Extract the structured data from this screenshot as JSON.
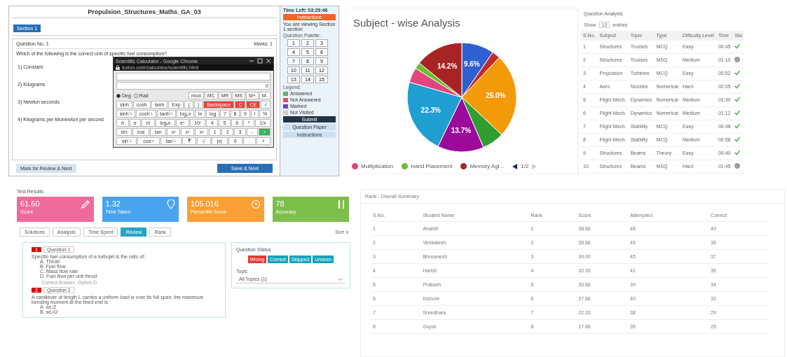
{
  "exam": {
    "title": "Propulsion_Structures_Maths_GA_03",
    "section_button": "Section 1",
    "question_heading": "Question No. 1",
    "marks": "Marks: 1",
    "question": "Which of the following is the correct unit of specific fuel consumption?",
    "options": [
      "1) Constant",
      "2) Kilograms",
      "3) Newton seconds",
      "4) Kilograms per kilonewton per second"
    ],
    "back_button": "Mark for Review & Next",
    "next_button": "Save & Next",
    "calculator": {
      "title": "Scientific Calculator - Google Chrome",
      "url": "tcsion.com/calculator/scientific.html",
      "display": "0",
      "modes": [
        {
          "label": "Deg",
          "selected": true
        },
        {
          "label": "Rad",
          "selected": false
        }
      ],
      "keys": [
        [
          {
            "label": "mod",
            "kind": "std"
          },
          {
            "label": "MC",
            "kind": "std"
          },
          {
            "label": "MR",
            "kind": "std"
          },
          {
            "label": "MS",
            "kind": "std"
          },
          {
            "label": "M+",
            "kind": "std"
          },
          {
            "label": "M-",
            "kind": "std"
          }
        ],
        [
          {
            "label": "sinh",
            "kind": "std"
          },
          {
            "label": "cosh",
            "kind": "std"
          },
          {
            "label": "tanh",
            "kind": "std"
          },
          {
            "label": "Exp",
            "kind": "std"
          },
          {
            "label": "(",
            "kind": "std"
          },
          {
            "label": ")",
            "kind": "std"
          },
          {
            "label": "Backspace",
            "kind": "danger"
          },
          {
            "label": "C",
            "kind": "danger"
          },
          {
            "label": "CE",
            "kind": "danger"
          },
          {
            "label": "√",
            "kind": "std"
          }
        ],
        [
          {
            "label": "sinh⁻¹",
            "kind": "std"
          },
          {
            "label": "cosh⁻¹",
            "kind": "std"
          },
          {
            "label": "tanh⁻¹",
            "kind": "std"
          },
          {
            "label": "log₂x",
            "kind": "std"
          },
          {
            "label": "ln",
            "kind": "std"
          },
          {
            "label": "log",
            "kind": "std"
          },
          {
            "label": "7",
            "kind": "std"
          },
          {
            "label": "8",
            "kind": "std"
          },
          {
            "label": "9",
            "kind": "std"
          },
          {
            "label": "/",
            "kind": "std"
          },
          {
            "label": "%",
            "kind": "std"
          }
        ],
        [
          {
            "label": "π",
            "kind": "std"
          },
          {
            "label": "e",
            "kind": "std"
          },
          {
            "label": "n!",
            "kind": "std"
          },
          {
            "label": "logᵧx",
            "kind": "std"
          },
          {
            "label": "eˣ",
            "kind": "std"
          },
          {
            "label": "10ˣ",
            "kind": "std"
          },
          {
            "label": "4",
            "kind": "std"
          },
          {
            "label": "5",
            "kind": "std"
          },
          {
            "label": "6",
            "kind": "std"
          },
          {
            "label": "*",
            "kind": "std"
          },
          {
            "label": "1/x",
            "kind": "std"
          }
        ],
        [
          {
            "label": "sin",
            "kind": "std"
          },
          {
            "label": "cos",
            "kind": "std"
          },
          {
            "label": "tan",
            "kind": "std"
          },
          {
            "label": "xʸ",
            "kind": "std"
          },
          {
            "label": "x³",
            "kind": "std"
          },
          {
            "label": "x²",
            "kind": "std"
          },
          {
            "label": "1",
            "kind": "std"
          },
          {
            "label": "2",
            "kind": "std"
          },
          {
            "label": "3",
            "kind": "std"
          },
          {
            "label": "-",
            "kind": "std"
          },
          {
            "label": "=",
            "kind": "equals"
          }
        ],
        [
          {
            "label": "sin⁻¹",
            "kind": "std"
          },
          {
            "label": "cos⁻¹",
            "kind": "std"
          },
          {
            "label": "tan⁻¹",
            "kind": "std"
          },
          {
            "label": "∛",
            "kind": "std"
          },
          {
            "label": "√",
            "kind": "std"
          },
          {
            "label": "|x|",
            "kind": "std"
          },
          {
            "label": "0",
            "kind": "std"
          },
          {
            "label": ".",
            "kind": "std"
          },
          {
            "label": "+",
            "kind": "std"
          }
        ]
      ]
    },
    "sidebar": {
      "time_left": "Time Left: 03:29:46",
      "instructions_button": "Instructions",
      "viewing_text": "You are viewing Section 1 section",
      "palette_heading": "Question Palette:",
      "questions": [
        "1",
        "2",
        "3",
        "4",
        "5",
        "6",
        "7",
        "8",
        "9",
        "10",
        "11",
        "12",
        "13",
        "14",
        "15"
      ],
      "legend_heading": "Legend:",
      "legend": [
        {
          "label": "Answered",
          "color": "#5cb85c"
        },
        {
          "label": "Not Answered",
          "color": "#d9534f"
        },
        {
          "label": "Marked",
          "color": "#6f42c1"
        },
        {
          "label": "Not Visited",
          "color": "#cccccc"
        }
      ],
      "submit_button": "Submit",
      "paper_button": "Question Paper",
      "instructions_link": "Instructions"
    }
  },
  "subject_analysis": {
    "chart_data": {
      "type": "pie",
      "title": "Subject - wise Analysis",
      "series": [
        {
          "values": [
            9.6,
            2.4,
            25.0,
            6.5,
            13.7,
            22.3,
            4.4,
            1.9,
            14.2
          ]
        }
      ],
      "colors": [
        "#2f5fd0",
        "#c62828",
        "#f39a0b",
        "#2e9e2e",
        "#9c0a9c",
        "#1f9ed1",
        "#e0457b",
        "#6bbf2f",
        "#a82424"
      ],
      "value_labels": [
        "9.6%",
        null,
        "25.0%",
        null,
        "13.7%",
        "22.3%",
        null,
        null,
        "14.2%"
      ]
    },
    "legend": [
      {
        "label": "Multiplication",
        "color": "#e0457b"
      },
      {
        "label": "Hand Placement",
        "color": "#6bbf2f"
      },
      {
        "label": "Memory Agi...",
        "color": "#a82424"
      }
    ],
    "page": "1/2"
  },
  "question_analysis": {
    "title": "Question Analysis",
    "show_label": "Show",
    "entries_value": "10",
    "entries_label": "entries",
    "columns": [
      "S.No.",
      "Subject",
      "Topic",
      "Type",
      "Difficulty Level",
      "Time",
      "Sta"
    ],
    "rows": [
      {
        "cells": [
          "1",
          "Structures",
          "Trusses",
          "MCQ",
          "Easy",
          "00:45"
        ],
        "correct": true
      },
      {
        "cells": [
          "2",
          "Structures",
          "Trusses",
          "MSQ",
          "Medium",
          "01:10"
        ],
        "correct": false
      },
      {
        "cells": [
          "3",
          "Propulsion",
          "Turbines",
          "MCQ",
          "Easy",
          "00:52"
        ],
        "correct": true
      },
      {
        "cells": [
          "4",
          "Aero",
          "Nozzles",
          "Numerical",
          "Hard",
          "02:05"
        ],
        "correct": true
      },
      {
        "cells": [
          "5",
          "Flight Mech.",
          "Dynamics",
          "Numerical",
          "Medium",
          "01:30"
        ],
        "correct": true
      },
      {
        "cells": [
          "6",
          "Flight Mech.",
          "Dynamics",
          "Numerical",
          "Medium",
          "01:12"
        ],
        "correct": true
      },
      {
        "cells": [
          "7",
          "Flight Mech.",
          "Stability",
          "MCQ",
          "Easy",
          "00:48"
        ],
        "correct": true
      },
      {
        "cells": [
          "8",
          "Flight Mech.",
          "Stability",
          "MCQ",
          "Medium",
          "00:58"
        ],
        "correct": true
      },
      {
        "cells": [
          "9",
          "Structures",
          "Beams",
          "Theory",
          "Easy",
          "00:40"
        ],
        "correct": true
      },
      {
        "cells": [
          "10",
          "Structures",
          "Beams",
          "MSQ",
          "Hard",
          "01:45"
        ],
        "correct": false
      }
    ]
  },
  "result_dashboard": {
    "heading": "Test Results",
    "stats": [
      {
        "value": "61.60",
        "label": "Score",
        "color": "#ef6b9b",
        "kind": "pencil"
      },
      {
        "value": "1.32",
        "label": "Time Taken",
        "color": "#4aa3ee",
        "kind": "pin"
      },
      {
        "value": "105.016",
        "label": "Percentile Score",
        "color": "#f8a035",
        "kind": "clock"
      },
      {
        "value": "78",
        "label": "Accuracy",
        "color": "#7dbf4b",
        "kind": "bars"
      }
    ],
    "tabs": [
      {
        "label": "Solutions",
        "selected": false
      },
      {
        "label": "Analysis",
        "selected": false
      },
      {
        "label": "Time Spent",
        "selected": false
      },
      {
        "label": "Review",
        "selected": true
      },
      {
        "label": "Rank",
        "selected": false
      }
    ],
    "sort_label": "Sort ∨",
    "questions": [
      {
        "number": "1",
        "title": "Question 1",
        "text": "Specific fuel consumption of a turbojet is the ratio of:",
        "options": [
          "A. Thrust",
          "B. Fuel flow",
          "C. Mass flow rate",
          "D. Fuel flow per unit thrust"
        ],
        "answer": "Correct Answer: Option D"
      },
      {
        "number": "2",
        "title": "Question 2",
        "text": "A cantilever of length L carries a uniform load w over its full span; the maximum bending moment at the fixed end is",
        "options": [
          "A. wL/2",
          "B. wL²/2"
        ]
      }
    ],
    "status_heading": "Question Status",
    "status_buttons": [
      {
        "label": "Wrong",
        "color": "#e53935"
      },
      {
        "label": "Correct",
        "color": "#17a2b8"
      },
      {
        "label": "Skipped",
        "color": "#17a2b8"
      },
      {
        "label": "Unseen",
        "color": "#17a2b8"
      }
    ],
    "filter_label": "Topic",
    "filter_value": "All Topics (1)"
  },
  "rank_summary": {
    "title": "Rank - Overall Summary",
    "columns": [
      "S.No.",
      "Student Name",
      "Rank",
      "Score",
      "Attempted",
      "Correct"
    ],
    "rows": [
      [
        "1",
        "Ananth",
        "1",
        "38.66",
        "48",
        "40"
      ],
      [
        "2",
        "Venkatesh",
        "2",
        "35.66",
        "45",
        "36"
      ],
      [
        "3",
        "Bhuvanesh",
        "3",
        "34.00",
        "45",
        "37"
      ],
      [
        "4",
        "Harish",
        "4",
        "32.33",
        "41",
        "35"
      ],
      [
        "5",
        "Prakash",
        "5",
        "30.66",
        "39",
        "34"
      ],
      [
        "6",
        "Kishore",
        "6",
        "27.66",
        "40",
        "32"
      ],
      [
        "7",
        "Sreedhara",
        "7",
        "22.33",
        "38",
        "29"
      ],
      [
        "8",
        "Gopal",
        "8",
        "17.66",
        "35",
        "25"
      ]
    ]
  }
}
